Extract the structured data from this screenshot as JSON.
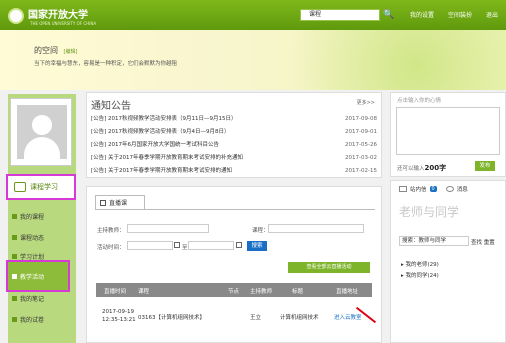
{
  "header": {
    "logo_text": "国家开放大学",
    "logo_sub": "THE OPEN UNIVERSITY OF CHINA",
    "search_value": "课程",
    "links": [
      "我的设置",
      "空间装扮",
      "退出"
    ]
  },
  "banner": {
    "space_title": "的空间",
    "edit_label": "[编辑]",
    "motto": "当下的幸福与慧东，容易是一种积定，它们会默默为你越阻"
  },
  "sidebar": {
    "main_label": "课程学习",
    "items": [
      "我的课程",
      "课程动态",
      "学习计划",
      "教学活动",
      "我的笔记",
      "我的试卷"
    ]
  },
  "notice": {
    "title": "通知公告",
    "more": "更多>>",
    "items": [
      {
        "title": "[公告] 2017秋视频教学活动安排表（9月11日—9月15日）",
        "date": "2017-09-08"
      },
      {
        "title": "[公告] 2017秋视频教学活动安排表（9月4日—9月8日）",
        "date": "2017-09-01"
      },
      {
        "title": "[公告] 2017年6月国家开放大学国统一考试科目公告",
        "date": "2017-05-26"
      },
      {
        "title": "[公告] 关于2017年春季学期开放教育期末考试安排的补充通知",
        "date": "2017-03-02"
      },
      {
        "title": "[公告] 关于2017年春季学期开放教育期末考试安排的通知",
        "date": "2017-02-15"
      }
    ]
  },
  "status_panel": {
    "prompt": "点击输入你的心情",
    "count_prefix": "还可以输入",
    "count_value": "200字",
    "publish": "发布"
  },
  "live": {
    "tab_label": "直播课",
    "labels": {
      "teacher": "主持教师：",
      "course": "课程：",
      "time": "活动时间：",
      "to": "至"
    },
    "search_button": "搜索",
    "all_button": "查看全部云直播活动",
    "columns": [
      "直播时间",
      "课程",
      "节点",
      "主持教师",
      "标题",
      "直播地址"
    ],
    "rows": [
      {
        "time_line1": "2017-09-19",
        "time_line2": "12:35-13:21",
        "course": "03163【计算机组网技术】",
        "node": "",
        "teacher": "王立",
        "title": "计算机组网技术",
        "link": "进入云教室"
      }
    ]
  },
  "friends": {
    "inbox_label": "站内信",
    "inbox_count": "0",
    "message_label": "消息",
    "title": "老师与同学",
    "search_value": "搜索：教师与同学",
    "search_links": "查找 重置",
    "groups": [
      "我的老师(29)",
      "我的同学(24)"
    ]
  }
}
